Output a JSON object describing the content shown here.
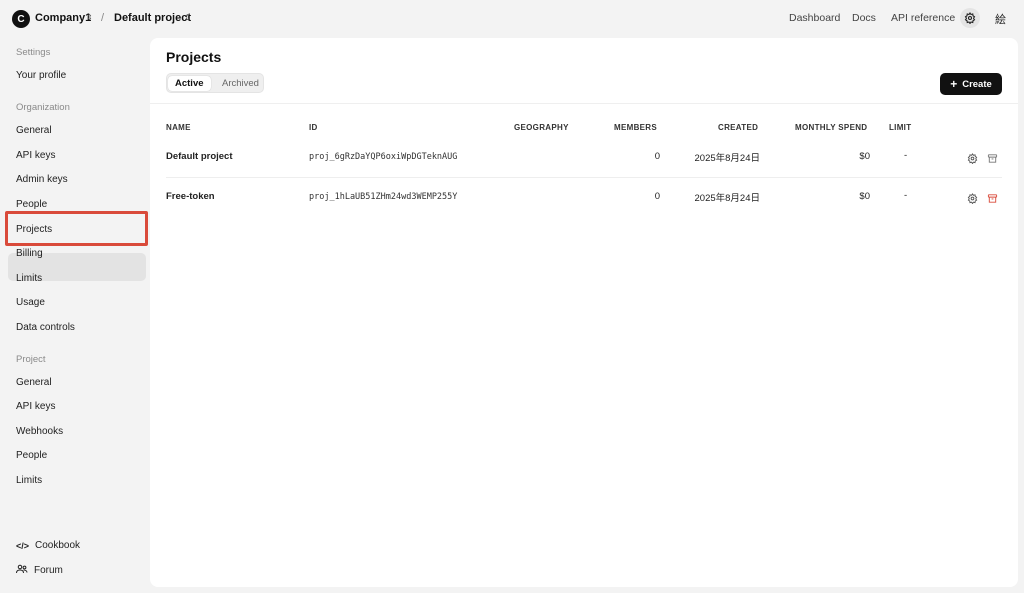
{
  "topbar": {
    "org_initial": "C",
    "org_name": "Company1",
    "separator": "/",
    "project_name": "Default project",
    "links": [
      "Dashboard",
      "Docs",
      "API reference"
    ],
    "user_glyph": "絵"
  },
  "sidebar": {
    "settings_label": "Settings",
    "your_profile": "Your profile",
    "organization_label": "Organization",
    "org_items": [
      "General",
      "API keys",
      "Admin keys",
      "People",
      "Projects",
      "Billing",
      "Limits",
      "Usage",
      "Data controls"
    ],
    "project_label": "Project",
    "project_items": [
      "General",
      "API keys",
      "Webhooks",
      "People",
      "Limits"
    ],
    "footer": [
      "Cookbook",
      "Forum"
    ],
    "active_item": "Projects"
  },
  "main": {
    "title": "Projects",
    "tabs": [
      "Active",
      "Archived"
    ],
    "create_label": "Create",
    "columns": [
      "NAME",
      "ID",
      "GEOGRAPHY",
      "MEMBERS",
      "CREATED",
      "MONTHLY SPEND",
      "LIMIT"
    ],
    "rows": [
      {
        "name": "Default project",
        "id": "proj_6gRzDaYQP6oxiWpDGTeknAUG",
        "geography": "",
        "members": "0",
        "created": "2025年8月24日",
        "spend": "$0",
        "limit": "-"
      },
      {
        "name": "Free-token",
        "id": "proj_1hLaUB51ZHm24wd3WEMP255Y",
        "geography": "",
        "members": "0",
        "created": "2025年8月24日",
        "spend": "$0",
        "limit": "-"
      }
    ]
  },
  "colors": {
    "highlight": "#d94a3a",
    "archive_icon_active": "#d94a3a"
  }
}
